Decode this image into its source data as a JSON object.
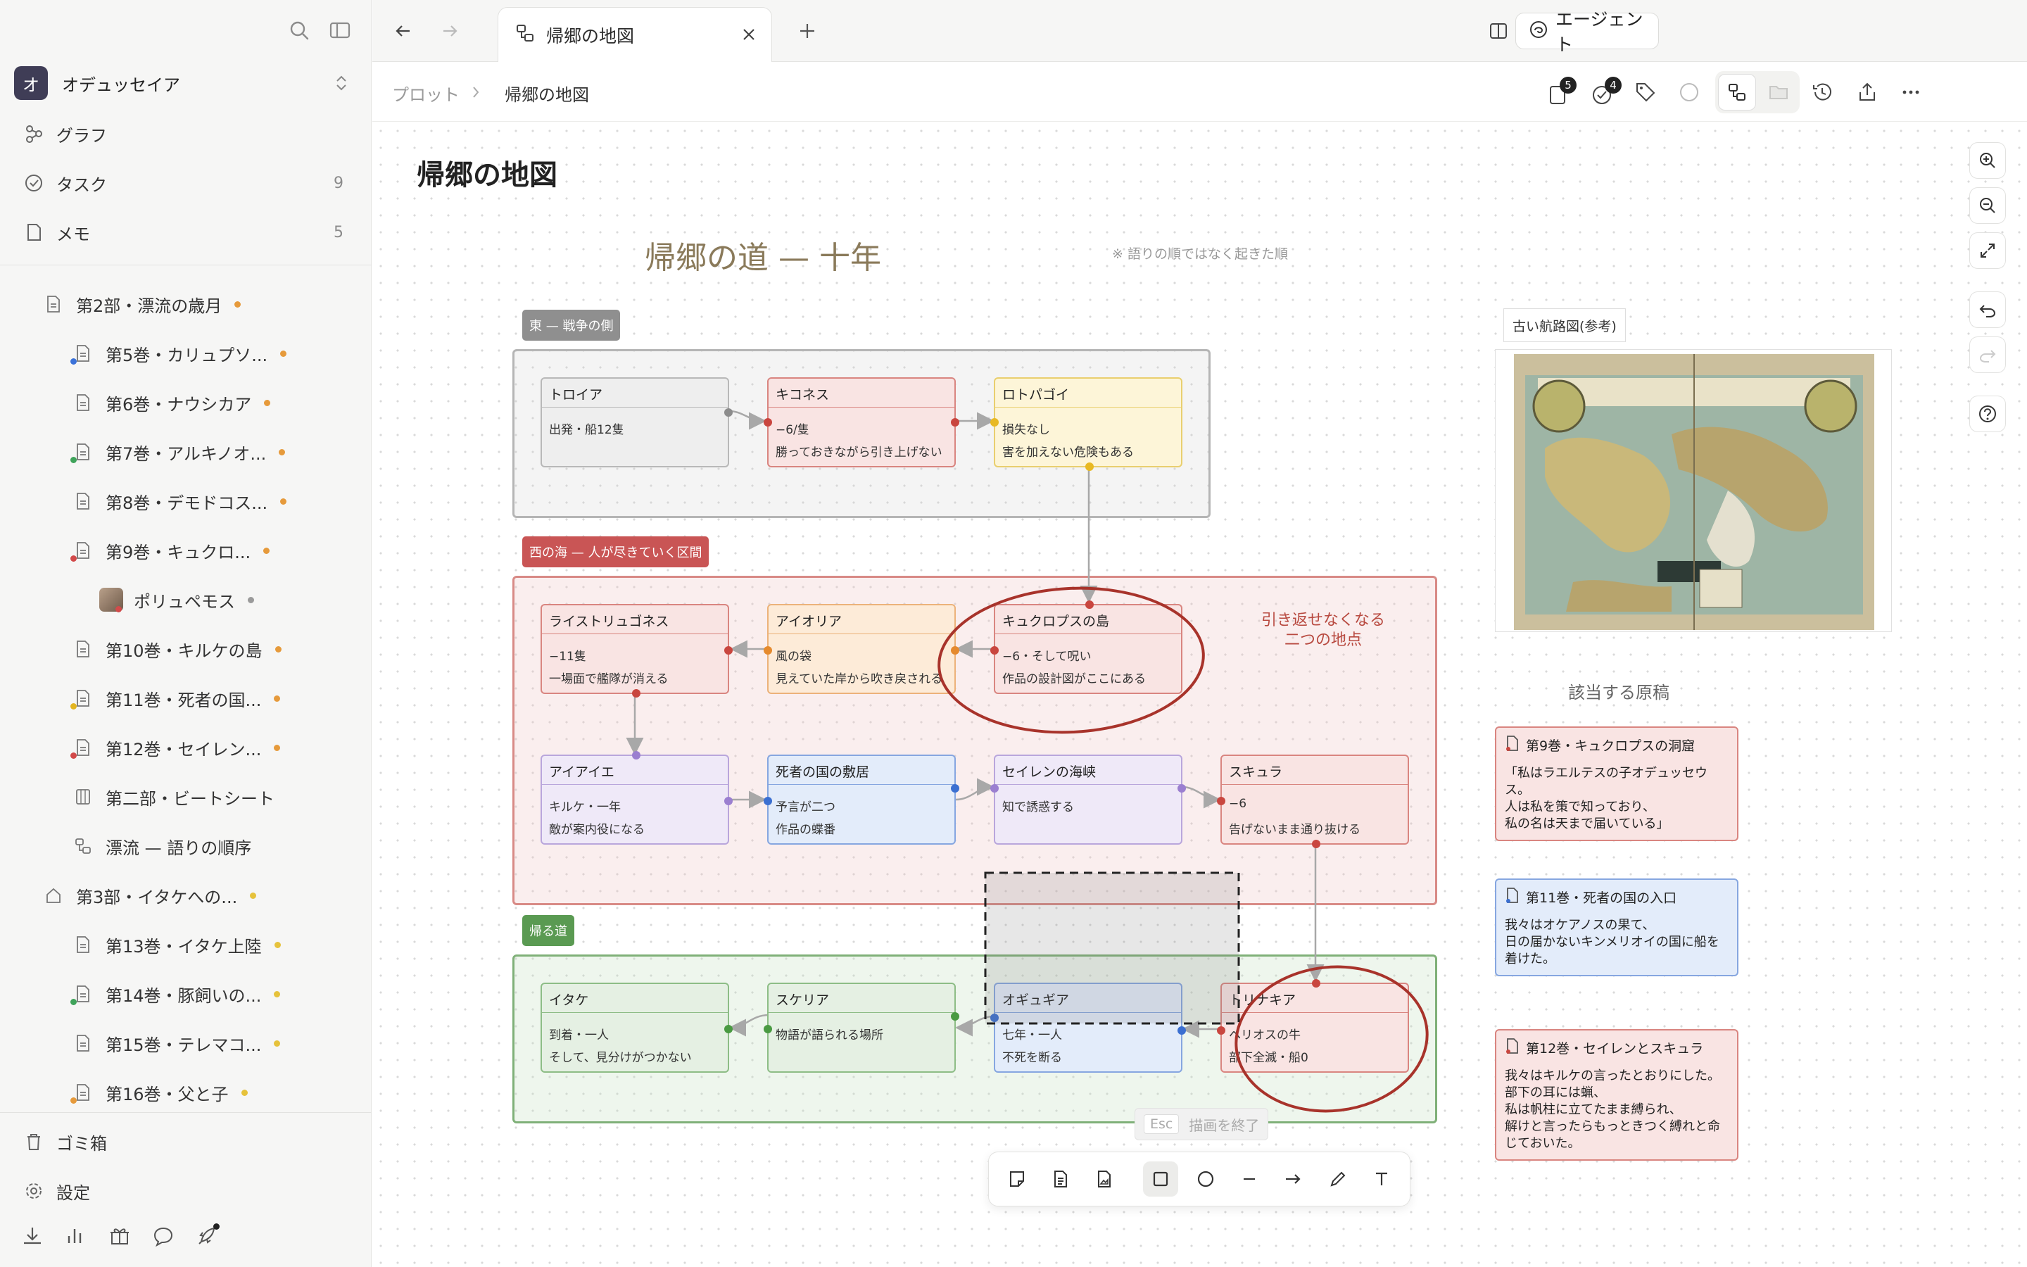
{
  "sidebar": {
    "workspace_initial": "オ",
    "workspace_name": "オデュッセイア",
    "nav": [
      {
        "label": "グラフ",
        "count": ""
      },
      {
        "label": "タスク",
        "count": "9"
      },
      {
        "label": "メモ",
        "count": "5"
      }
    ],
    "tree": [
      {
        "label": "第2部・漂流の歳月",
        "dot": "#e69a3b",
        "indent": 0,
        "icon": "doc"
      },
      {
        "label": "第5巻・カリュプソ...",
        "dot": "#e69a3b",
        "indent": 1,
        "icon": "doc",
        "sdot": "#3b72d9"
      },
      {
        "label": "第6巻・ナウシカア",
        "dot": "#e69a3b",
        "indent": 1,
        "icon": "doc"
      },
      {
        "label": "第7巻・アルキノオ...",
        "dot": "#e69a3b",
        "indent": 1,
        "icon": "doc",
        "sdot": "#3fa35a"
      },
      {
        "label": "第8巻・デモドコス...",
        "dot": "#e69a3b",
        "indent": 1,
        "icon": "doc"
      },
      {
        "label": "第9巻・キュクロ...",
        "dot": "#e69a3b",
        "indent": 1,
        "icon": "doc",
        "sdot": "#d24a4a"
      },
      {
        "label": "ポリュペモス",
        "dot": "#9a9a9a",
        "indent": 2,
        "icon": "avatar"
      },
      {
        "label": "第10巻・キルケの島",
        "dot": "#e69a3b",
        "indent": 1,
        "icon": "doc"
      },
      {
        "label": "第11巻・死者の国...",
        "dot": "#e69a3b",
        "indent": 1,
        "icon": "doc",
        "sdot": "#e3b520"
      },
      {
        "label": "第12巻・セイレン...",
        "dot": "#e69a3b",
        "indent": 1,
        "icon": "doc",
        "sdot": "#d24a4a"
      },
      {
        "label": "第二部・ビートシート",
        "dot": "",
        "indent": 1,
        "icon": "board"
      },
      {
        "label": "漂流 — 語りの順序",
        "dot": "",
        "indent": 1,
        "icon": "graph"
      },
      {
        "label": "第3部・イタケへの...",
        "dot": "#e6c23b",
        "indent": 0,
        "icon": "home"
      },
      {
        "label": "第13巻・イタケ上陸",
        "dot": "#e6c23b",
        "indent": 1,
        "icon": "doc"
      },
      {
        "label": "第14巻・豚飼いの...",
        "dot": "#e6c23b",
        "indent": 1,
        "icon": "doc",
        "sdot": "#3fa35a"
      },
      {
        "label": "第15巻・テレマコ...",
        "dot": "#e6c23b",
        "indent": 1,
        "icon": "doc"
      },
      {
        "label": "第16巻・父と子",
        "dot": "#e6c23b",
        "indent": 1,
        "icon": "doc",
        "sdot": "#e69a3b"
      }
    ],
    "trash": "ゴミ箱",
    "settings": "設定"
  },
  "topbar": {
    "tab_title": "帰郷の地図",
    "agent_label": "エージェント"
  },
  "breadcrumb": {
    "parent": "プロット",
    "current": "帰郷の地図",
    "badge_docs": "5",
    "badge_tasks": "4"
  },
  "canvas": {
    "page_title": "帰郷の地図",
    "board_title": "帰郷の道 — 十年",
    "board_note": "※ 語りの順ではなく起きた順",
    "group_east": "東 — 戦争の側",
    "group_west": "西の海 — 人が尽きていく区間",
    "group_home": "帰る道",
    "annotation": "引き返せなくなる\n二つの地点",
    "map_label": "古い航路図(参考)",
    "manuscripts_label": "該当する原稿",
    "cards": [
      {
        "title": "トロイア",
        "l1": "出発・船12隻",
        "l2": "",
        "color": "gray"
      },
      {
        "title": "キコネス",
        "l1": "−6/隻",
        "l2": "勝っておきながら引き上げない",
        "color": "red"
      },
      {
        "title": "ロトパゴイ",
        "l1": "損失なし",
        "l2": "害を加えない危険もある",
        "color": "yellow"
      },
      {
        "title": "ライストリュゴネス",
        "l1": "−11隻",
        "l2": "一場面で艦隊が消える",
        "color": "red"
      },
      {
        "title": "アイオリア",
        "l1": "風の袋",
        "l2": "見えていた岸から吹き戻される",
        "color": "orange"
      },
      {
        "title": "キュクロプスの島",
        "l1": "−6・そして呪い",
        "l2": "作品の設計図がここにある",
        "color": "red"
      },
      {
        "title": "アイアイエ",
        "l1": "キルケ・一年",
        "l2": "敵が案内役になる",
        "color": "purple"
      },
      {
        "title": "死者の国の敷居",
        "l1": "予言が二つ",
        "l2": "作品の蝶番",
        "color": "blue"
      },
      {
        "title": "セイレンの海峡",
        "l1": "知で誘惑する",
        "l2": "",
        "color": "purple"
      },
      {
        "title": "スキュラ",
        "l1": "−6",
        "l2": "告げないまま通り抜ける",
        "color": "red"
      },
      {
        "title": "イタケ",
        "l1": "到着・一人",
        "l2": "そして、見分けがつかない",
        "color": "green"
      },
      {
        "title": "スケリア",
        "l1": "物語が語られる場所",
        "l2": "",
        "color": "green"
      },
      {
        "title": "オギュギア",
        "l1": "七年・一人",
        "l2": "不死を断る",
        "color": "blue"
      },
      {
        "title": "トリナキア",
        "l1": "ヘリオスの牛",
        "l2": "部下全滅・船0",
        "color": "red"
      }
    ],
    "notes": [
      {
        "title": "第9巻・キュクロプスの洞窟",
        "body": "「私はラエルテスの子オデュッセウス。\n人は私を策で知っており、\n私の名は天まで届いている」",
        "color": "red"
      },
      {
        "title": "第11巻・死者の国の入口",
        "body": "我々はオケアノスの果て、\n日の届かないキンメリオイの国に船を着けた。",
        "color": "blue"
      },
      {
        "title": "第12巻・セイレンとスキュラ",
        "body": "我々はキルケの言ったとおりにした。\n部下の耳には蝋、\n私は帆柱に立てたまま縛られ、\n解けと言ったらもっときつく縛れと命じておいた。",
        "color": "red"
      }
    ],
    "esc_key": "Esc",
    "esc_label": "描画を終了"
  },
  "colors": {
    "gray": {
      "bg": "#eeeeee",
      "border": "#b8b8b8",
      "pt": "#8c8c8c"
    },
    "red": {
      "bg": "#f9e4e3",
      "border": "#d98580",
      "pt": "#c9463f"
    },
    "yellow": {
      "bg": "#fdf5d8",
      "border": "#e9cf6e",
      "pt": "#e8b923"
    },
    "orange": {
      "bg": "#fdebd8",
      "border": "#ecb27a",
      "pt": "#e58a2e"
    },
    "purple": {
      "bg": "#efe9f8",
      "border": "#b9a6dc",
      "pt": "#9b7fd0"
    },
    "blue": {
      "bg": "#e3ecfa",
      "border": "#86a6e0",
      "pt": "#3b6fd1"
    },
    "green": {
      "bg": "#e5f0e3",
      "border": "#8dbd86",
      "pt": "#4a9a42"
    }
  }
}
